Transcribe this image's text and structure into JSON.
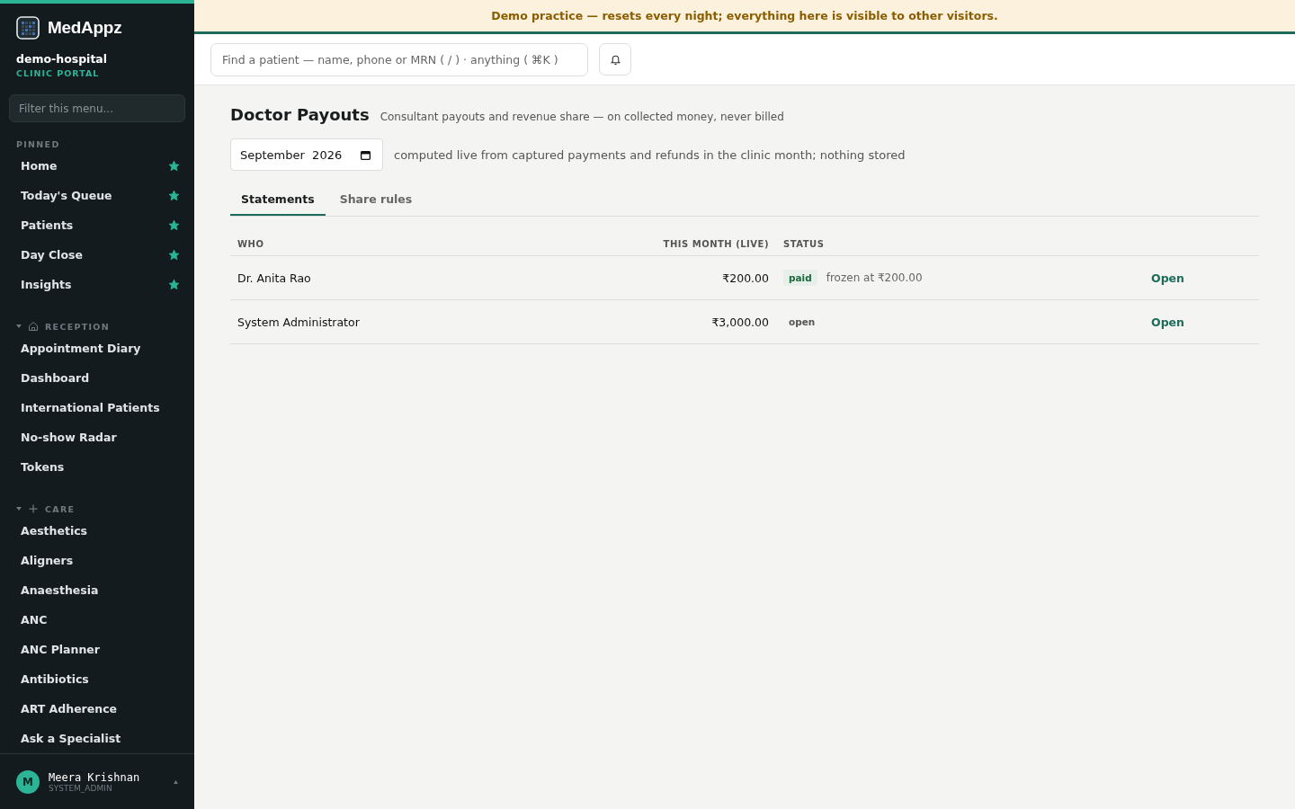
{
  "banner": "Demo practice — resets every night; everything here is visible to other visitors.",
  "sidebar": {
    "brand": "MedAppz",
    "org": "demo-hospital",
    "portal": "CLINIC PORTAL",
    "filter_placeholder": "Filter this menu...",
    "pinned_label": "PINNED",
    "pinned": [
      {
        "label": "Home",
        "starred": true
      },
      {
        "label": "Today's Queue",
        "starred": true
      },
      {
        "label": "Patients",
        "starred": true
      },
      {
        "label": "Day Close",
        "starred": true
      },
      {
        "label": "Insights",
        "starred": true
      }
    ],
    "sections": [
      {
        "label": "RECEPTION",
        "kind": "house",
        "expanded": true,
        "items": [
          "Appointment Diary",
          "Dashboard",
          "International Patients",
          "No-show Radar",
          "Tokens"
        ]
      },
      {
        "label": "CARE",
        "kind": "plus",
        "expanded": true,
        "items": [
          "Aesthetics",
          "Aligners",
          "Anaesthesia",
          "ANC",
          "ANC Planner",
          "Antibiotics",
          "ART Adherence",
          "Ask a Specialist"
        ]
      }
    ],
    "user": {
      "initial": "M",
      "name": "Meera Krishnan",
      "role": "SYSTEM_ADMIN"
    }
  },
  "search": {
    "placeholder": "Find a patient — name, phone or MRN ( / ) · anything ( ⌘K )"
  },
  "page": {
    "title": "Doctor Payouts",
    "subtitle": "Consultant payouts and revenue share — on collected money, never billed",
    "month": "September  2026",
    "note": "computed live from captured payments and refunds in the clinic month; nothing stored",
    "tabs": [
      {
        "label": "Statements",
        "selected": true
      },
      {
        "label": "Share rules",
        "selected": false
      }
    ],
    "table": {
      "columns": [
        "WHO",
        "THIS MONTH (LIVE)",
        "STATUS"
      ],
      "rows": [
        {
          "who": "Dr. Anita Rao",
          "amount": "₹200.00",
          "status": "paid",
          "settled": true,
          "detail": "frozen at ₹200.00",
          "action": "Open"
        },
        {
          "who": "System Administrator",
          "amount": "₹3,000.00",
          "status": "open",
          "settled": false,
          "action": "Open"
        }
      ]
    }
  }
}
